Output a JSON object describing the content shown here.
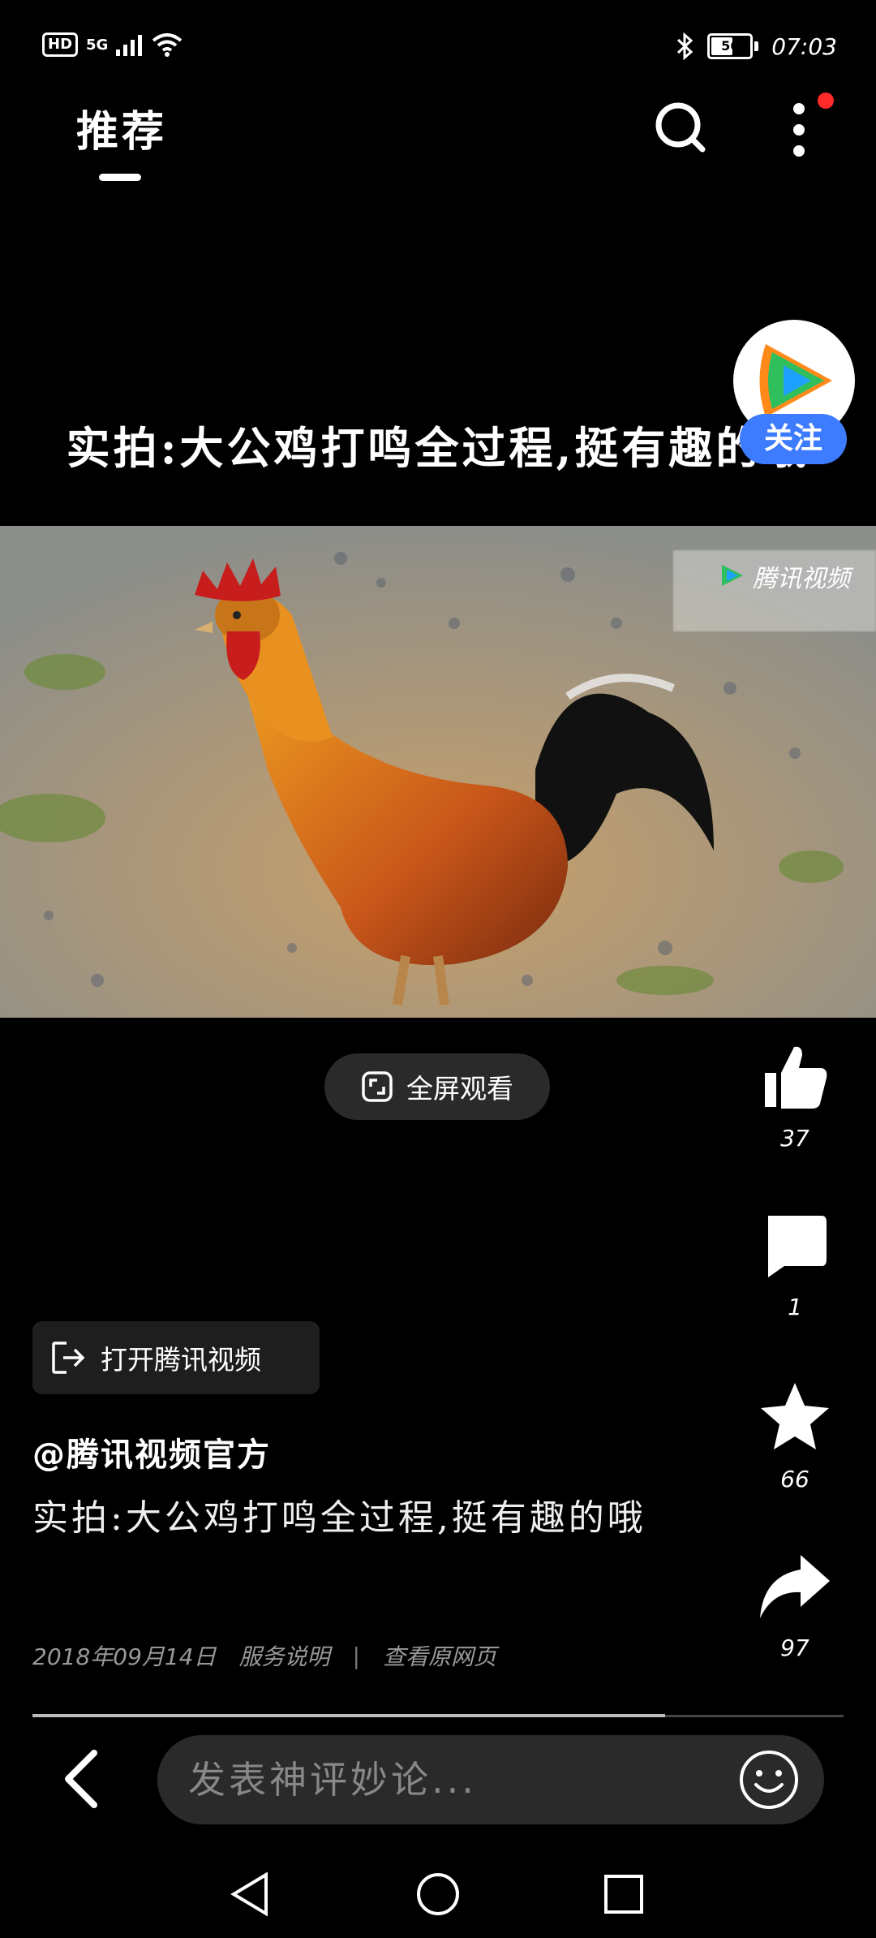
{
  "status_bar": {
    "hd": "HD",
    "network": "5G",
    "battery": "56",
    "time": "07:03"
  },
  "header": {
    "tab": "推荐"
  },
  "video": {
    "title": "实拍:大公鸡打鸣全过程,挺有趣的哦",
    "watermark": "腾讯视频",
    "follow_label": "关注"
  },
  "fullscreen_label": "全屏观看",
  "actions": {
    "likes": "37",
    "comments": "1",
    "favorites": "66",
    "shares": "97"
  },
  "open_app_label": "打开腾讯视频",
  "author": "@腾讯视频官方",
  "description": "实拍:大公鸡打鸣全过程,挺有趣的哦",
  "meta": {
    "date": "2018年09月14日",
    "service": "服务说明",
    "separator": "|",
    "view_original": "查看原网页"
  },
  "playback_progress_fraction": 0.78,
  "comment_input": {
    "placeholder": "发表神评妙论..."
  },
  "colors": {
    "background": "#000000",
    "accent": "#3d7bff",
    "notification_dot": "#ff2a2a"
  }
}
